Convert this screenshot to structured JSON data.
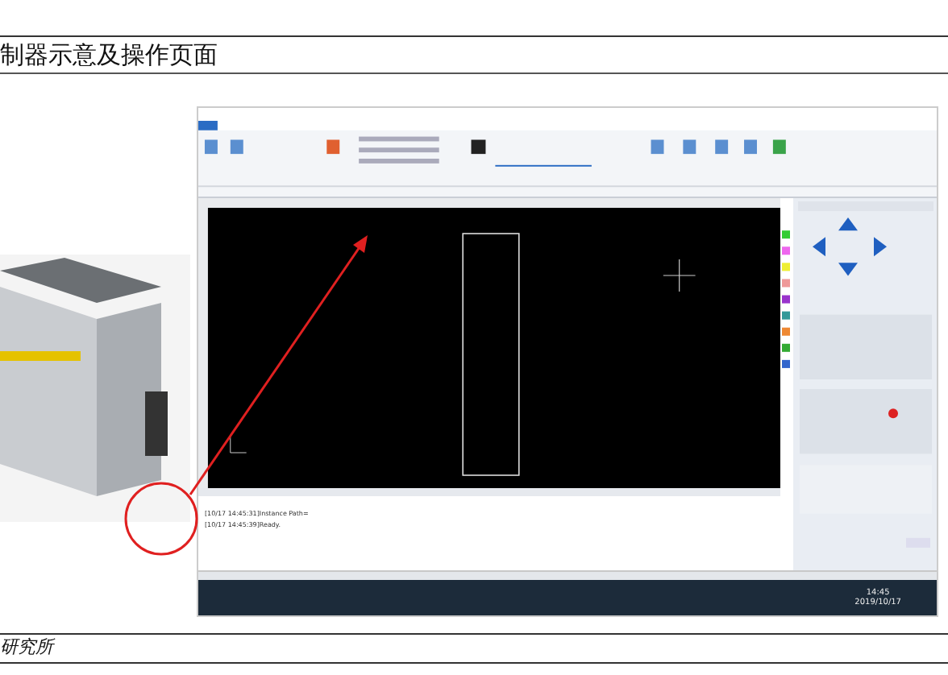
{
  "page": {
    "title": "制器示意及操作页面",
    "footer": "研究所"
  },
  "log": [
    "[10/17 14:45:31]Instance Path=",
    "[10/17 14:45:39]Ready."
  ],
  "taskbar": {
    "time": "14:45",
    "date": "2019/10/17"
  }
}
